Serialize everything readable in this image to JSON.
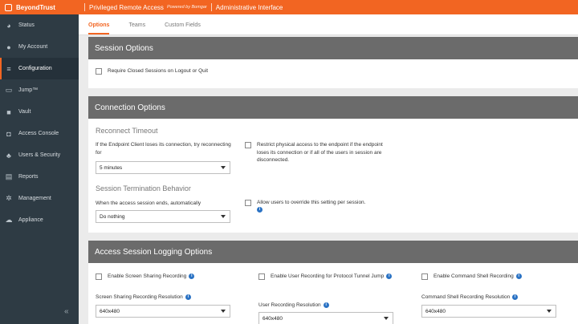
{
  "topbar": {
    "brand": "BeyondTrust",
    "product": "Privileged Remote Access",
    "powered": "Powered by Bomgar",
    "admin": "Administrative Interface"
  },
  "sidebar": {
    "items": [
      {
        "label": "Status",
        "icon": "gauge-icon"
      },
      {
        "label": "My Account",
        "icon": "user-icon"
      },
      {
        "label": "Configuration",
        "icon": "sliders-icon"
      },
      {
        "label": "Jump™",
        "icon": "jump-icon"
      },
      {
        "label": "Vault",
        "icon": "vault-icon"
      },
      {
        "label": "Access Console",
        "icon": "chat-icon"
      },
      {
        "label": "Users & Security",
        "icon": "users-icon"
      },
      {
        "label": "Reports",
        "icon": "report-icon"
      },
      {
        "label": "Management",
        "icon": "gear-icon"
      },
      {
        "label": "Appliance",
        "icon": "cloud-icon"
      }
    ],
    "collapse": "«"
  },
  "tabs": [
    "Options",
    "Teams",
    "Custom Fields"
  ],
  "session": {
    "title": "Session Options",
    "require_closed": "Require Closed Sessions on Logout or Quit"
  },
  "connection": {
    "title": "Connection Options",
    "reconnect_title": "Reconnect Timeout",
    "reconnect_label": "If the Endpoint Client loses its connection, try reconnecting for",
    "reconnect_value": "5 minutes",
    "restrict_label": "Restrict physical access to the endpoint if the endpoint loses its connection or if all of the users in session are disconnected.",
    "termination_title": "Session Termination Behavior",
    "termination_label": "When the access session ends, automatically",
    "termination_value": "Do nothing",
    "override_label": "Allow users to override this setting per session."
  },
  "logging": {
    "title": "Access Session Logging Options",
    "screen_sharing": "Enable Screen Sharing Recording",
    "user_recording": "Enable User Recording for Protocol Tunnel Jump",
    "command_shell": "Enable Command Shell Recording",
    "screen_res_label": "Screen Sharing Recording Resolution",
    "screen_res_value": "640x480",
    "user_res_label": "User Recording Resolution",
    "user_res_value": "640x480",
    "cmd_res_label": "Command Shell Recording Resolution",
    "cmd_res_value": "640x480"
  },
  "colors": {
    "accent": "#f26522",
    "sidebar": "#2e3b44",
    "panel_header": "#6b6b6b",
    "info": "#2a72c4"
  }
}
